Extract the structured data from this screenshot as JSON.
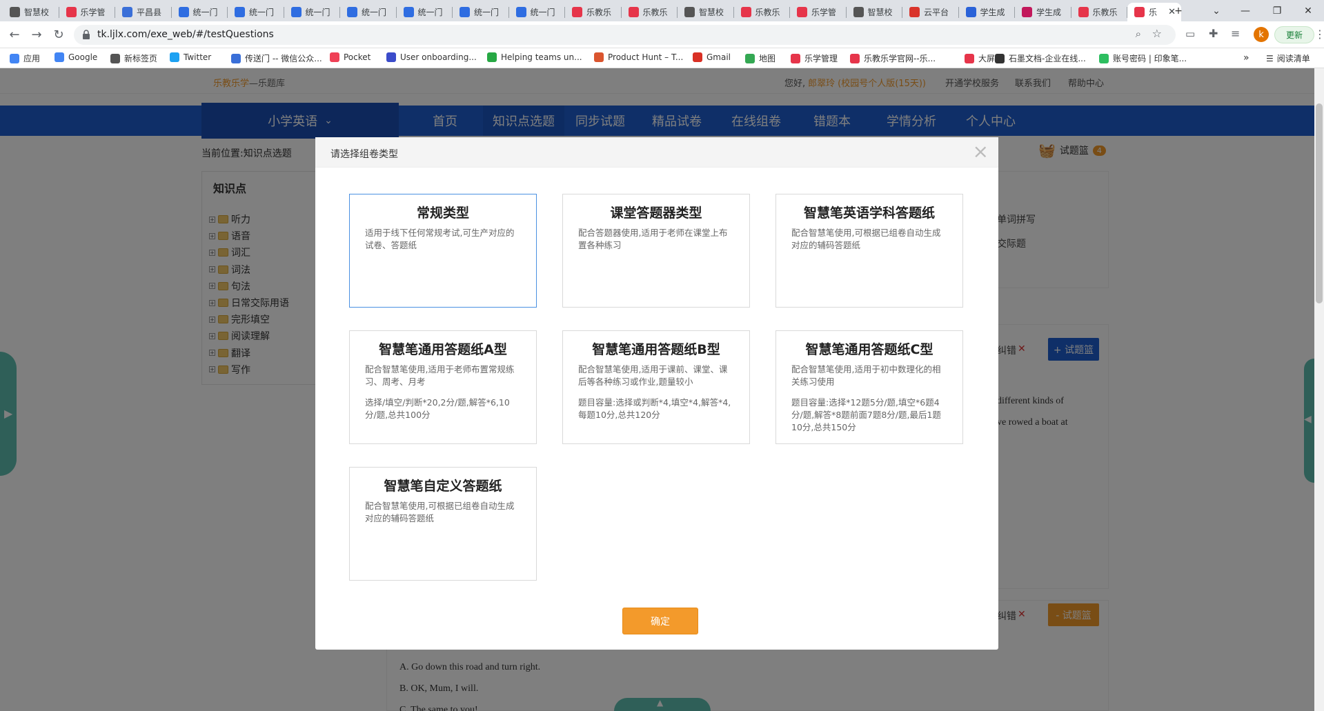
{
  "browser": {
    "tabs": [
      {
        "title": "智慧校",
        "color": "#555"
      },
      {
        "title": "乐学管",
        "color": "#e6354a"
      },
      {
        "title": "平昌县",
        "color": "#3a6fd8"
      },
      {
        "title": "统一门",
        "color": "#2f6de1"
      },
      {
        "title": "统一门",
        "color": "#2f6de1"
      },
      {
        "title": "统一门",
        "color": "#2f6de1"
      },
      {
        "title": "统一门",
        "color": "#2f6de1"
      },
      {
        "title": "统一门",
        "color": "#2f6de1"
      },
      {
        "title": "统一门",
        "color": "#2f6de1"
      },
      {
        "title": "统一门",
        "color": "#2f6de1"
      },
      {
        "title": "乐教乐",
        "color": "#e6354a"
      },
      {
        "title": "乐教乐",
        "color": "#e6354a"
      },
      {
        "title": "智慧校",
        "color": "#555"
      },
      {
        "title": "乐教乐",
        "color": "#e6354a"
      },
      {
        "title": "乐学管",
        "color": "#e6354a"
      },
      {
        "title": "智慧校",
        "color": "#555"
      },
      {
        "title": "云平台",
        "color": "#d9342b"
      },
      {
        "title": "学生成",
        "color": "#2a62d8"
      },
      {
        "title": "学生成",
        "color": "#c2185b"
      },
      {
        "title": "乐教乐",
        "color": "#e6354a"
      },
      {
        "title": "乐",
        "color": "#e6354a"
      }
    ],
    "new_tab": "+",
    "url": "tk.ljlx.com/exe_web/#/testQuestions",
    "update_label": "更新",
    "profile_initial": "k",
    "bookmarks": [
      {
        "label": "应用",
        "icon": "apps-icon",
        "color": "#4285f4"
      },
      {
        "label": "Google",
        "icon": "google-icon",
        "color": "#4285f4"
      },
      {
        "label": "新标签页",
        "icon": "newtab-icon",
        "color": "#555"
      },
      {
        "label": "Twitter",
        "icon": "twitter-icon",
        "color": "#1da1f2"
      },
      {
        "label": "传送门 -- 微信公众...",
        "icon": "portal-icon",
        "color": "#3a6fd8"
      },
      {
        "label": "Pocket",
        "icon": "pocket-icon",
        "color": "#ef4056"
      },
      {
        "label": "User onboarding...",
        "icon": "onboarding-icon",
        "color": "#3b4cca"
      },
      {
        "label": "Helping teams un...",
        "icon": "helping-icon",
        "color": "#27a844"
      },
      {
        "label": "Product Hunt – T...",
        "icon": "producthunt-icon",
        "color": "#da552f"
      },
      {
        "label": "Gmail",
        "icon": "gmail-icon",
        "color": "#d93025"
      },
      {
        "label": "地图",
        "icon": "map-icon",
        "color": "#34a853"
      },
      {
        "label": "乐学管理",
        "icon": "lexue-icon",
        "color": "#e6354a"
      },
      {
        "label": "乐教乐学官网--乐...",
        "icon": "lejiao-icon",
        "color": "#e6354a"
      },
      {
        "label": "大屏",
        "icon": "screen-icon",
        "color": "#e6354a"
      },
      {
        "label": "石墨文档-企业在线...",
        "icon": "shimo-icon",
        "color": "#333"
      },
      {
        "label": "账号密码 | 印象笔...",
        "icon": "evernote-icon",
        "color": "#2dbe60"
      }
    ],
    "more_bookmarks": "»",
    "reading_list": "阅读清单"
  },
  "site": {
    "brand": "乐教乐学",
    "brand_suffix": "—乐题库",
    "greeting": "您好,",
    "user_name": "郎翠玲",
    "user_plan": "(校园号个人版(15天))",
    "top_links": [
      "开通学校服务",
      "联系我们",
      "帮助中心"
    ],
    "subject": "小学英语",
    "nav": [
      "首页",
      "知识点选题",
      "同步试题",
      "精品试卷",
      "在线组卷",
      "错题本",
      "学情分析",
      "个人中心"
    ],
    "breadcrumb": "当前位置:知识点选题",
    "basket_label": "试题篮",
    "basket_count": "4",
    "sidebar_title": "知识点",
    "knowledge_points": [
      "听力",
      "语音",
      "词汇",
      "词法",
      "句法",
      "日常交际用语",
      "完形填空",
      "阅读理解",
      "翻译",
      "写作"
    ],
    "bg_right_snippets": [
      "单词拼写",
      "交际题",
      "纠错",
      "different kinds of",
      "ve rowed a boat at",
      "纠错"
    ],
    "add_basket": "+ 试题篮",
    "remove_basket": "- 试题篮",
    "bg_options": [
      "A. Go down this road and turn right.",
      "B. OK, Mum, I will.",
      "C. The same to you!"
    ]
  },
  "modal": {
    "title": "请选择组卷类型",
    "close": "×",
    "confirm": "确定",
    "cards": [
      {
        "title": "常规类型",
        "desc": "适用于线下任何常规考试,可生产对应的试卷、答题纸",
        "extra": "",
        "selected": true
      },
      {
        "title": "课堂答题器类型",
        "desc": "配合答题器使用,适用于老师在课堂上布置各种练习",
        "extra": "",
        "selected": false
      },
      {
        "title": "智慧笔英语学科答题纸",
        "desc": "配合智慧笔使用,可根据已组卷自动生成对应的辅码答题纸",
        "extra": "",
        "selected": false
      },
      {
        "title": "智慧笔通用答题纸A型",
        "desc": "配合智慧笔使用,适用于老师布置常规练习、周考、月考",
        "extra": "选择/填空/判断*20,2分/题,解答*6,10分/题,总共100分",
        "selected": false
      },
      {
        "title": "智慧笔通用答题纸B型",
        "desc": "配合智慧笔使用,适用于课前、课堂、课后等各种练习或作业,题量较小",
        "extra": "题目容量:选择或判断*4,填空*4,解答*4,每题10分,总共120分",
        "selected": false
      },
      {
        "title": "智慧笔通用答题纸C型",
        "desc": "配合智慧笔使用,适用于初中数理化的相关练习使用",
        "extra": "题目容量:选择*12题5分/题,填空*6题4分/题,解答*8题前面7题8分/题,最后1题10分,总共150分",
        "selected": false
      },
      {
        "title": "智慧笔自定义答题纸",
        "desc": "配合智慧笔使用,可根据已组卷自动生成对应的辅码答题纸",
        "extra": "",
        "selected": false
      }
    ]
  }
}
